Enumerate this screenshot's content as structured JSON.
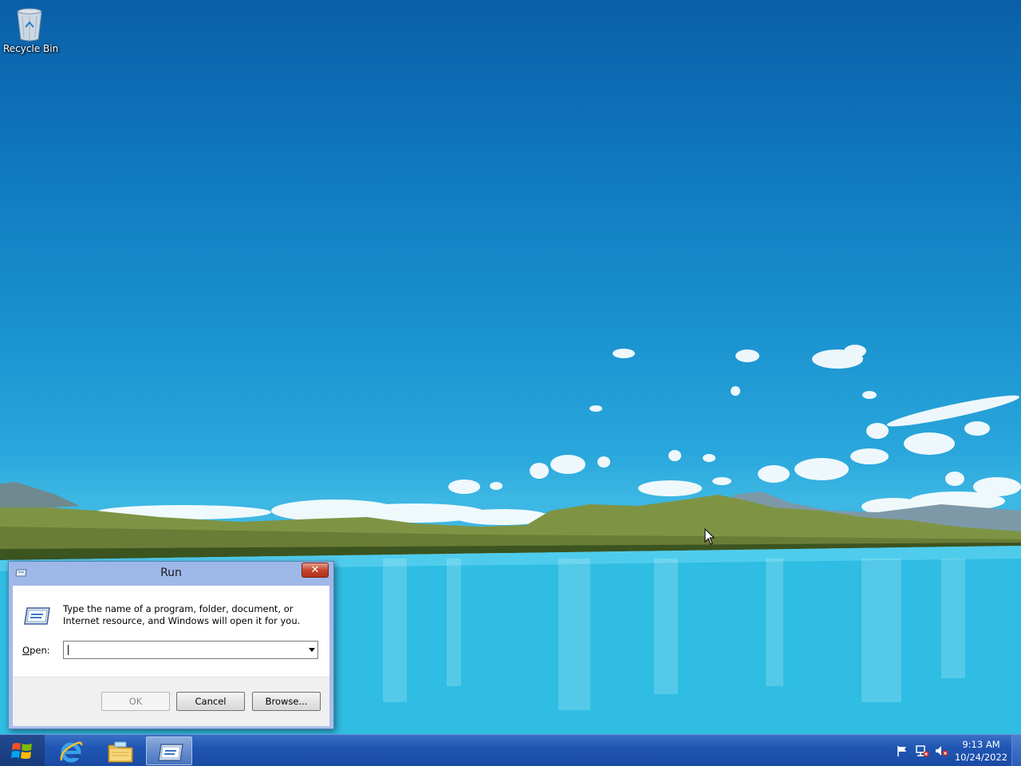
{
  "desktop": {
    "icons": [
      {
        "label": "Recycle Bin",
        "icon": "recycle-bin-icon"
      }
    ]
  },
  "run_dialog": {
    "title": "Run",
    "description": "Type the name of a program, folder, document, or Internet resource, and Windows will open it for you.",
    "open_label": "Open:",
    "open_value": "",
    "ok_label": "OK",
    "cancel_label": "Cancel",
    "browse_label": "Browse...",
    "close_glyph": "✕"
  },
  "taskbar": {
    "pinned": [
      {
        "name": "Internet Explorer",
        "icon": "internet-explorer-icon"
      },
      {
        "name": "File Explorer",
        "icon": "folder-icon"
      },
      {
        "name": "Run",
        "icon": "run-icon",
        "active": true
      }
    ],
    "tray_icons": [
      "action-center-flag-icon",
      "network-icon",
      "volume-muted-icon"
    ],
    "clock": {
      "time": "9:13 AM",
      "date": "10/24/2022"
    }
  }
}
